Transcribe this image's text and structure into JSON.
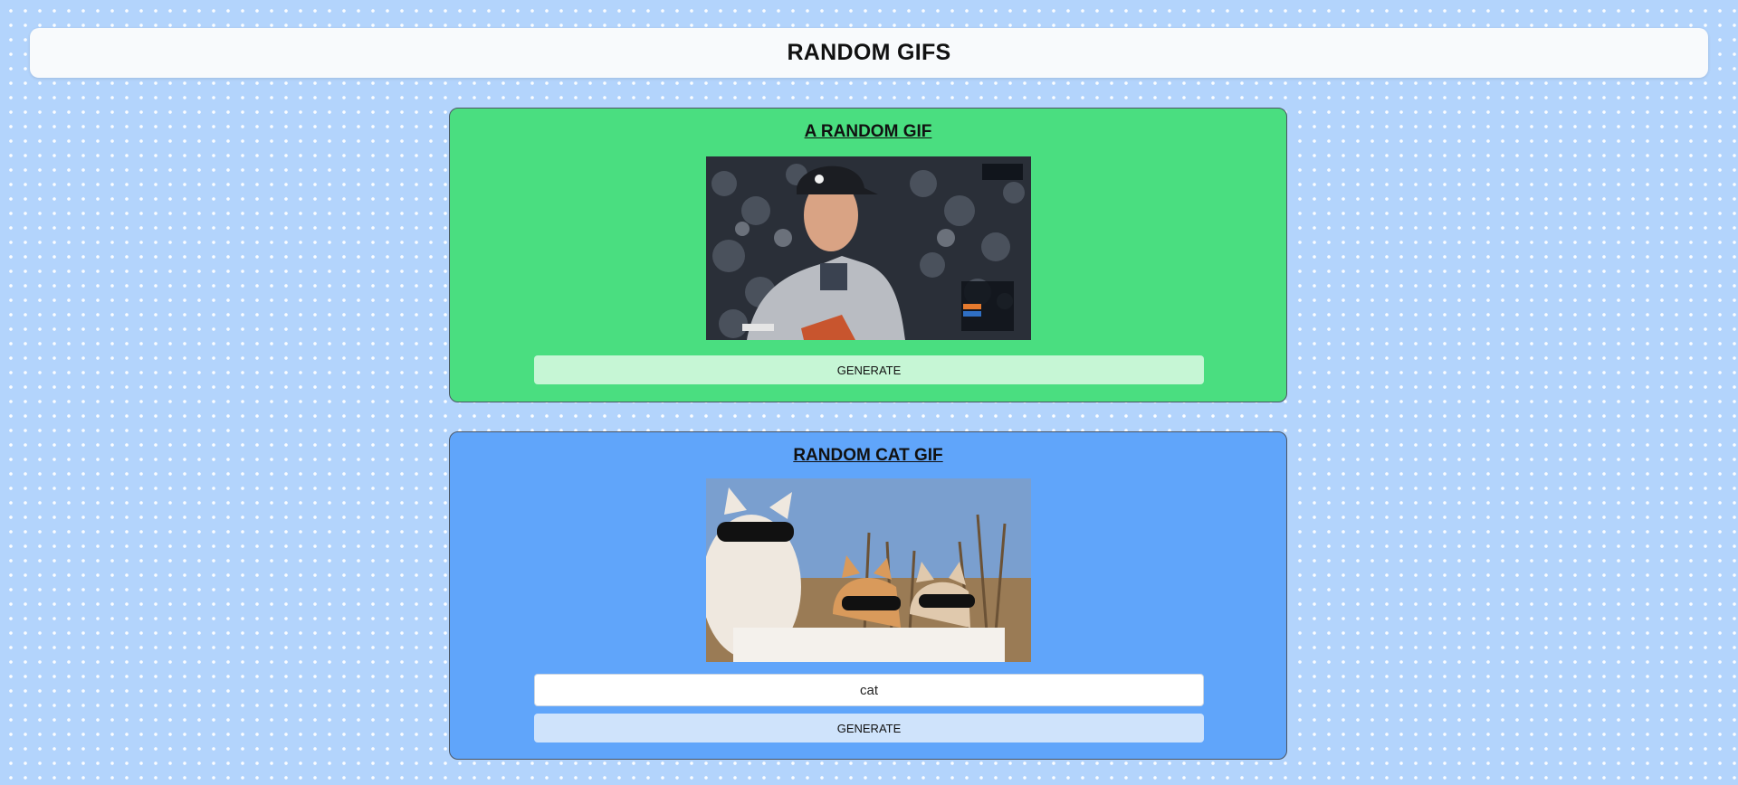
{
  "header": {
    "title": "RANDOM GIFS"
  },
  "random_gif": {
    "title": "A RANDOM GIF",
    "image_name": "baseball-pitcher-gif",
    "generate_label": "GENERATE",
    "color": "#4ade80"
  },
  "cat_gif": {
    "title": "RANDOM CAT GIF",
    "image_name": "cats-with-sunglasses-gif",
    "tag_value": "cat",
    "generate_label": "GENERATE",
    "color": "#60a5fa"
  }
}
